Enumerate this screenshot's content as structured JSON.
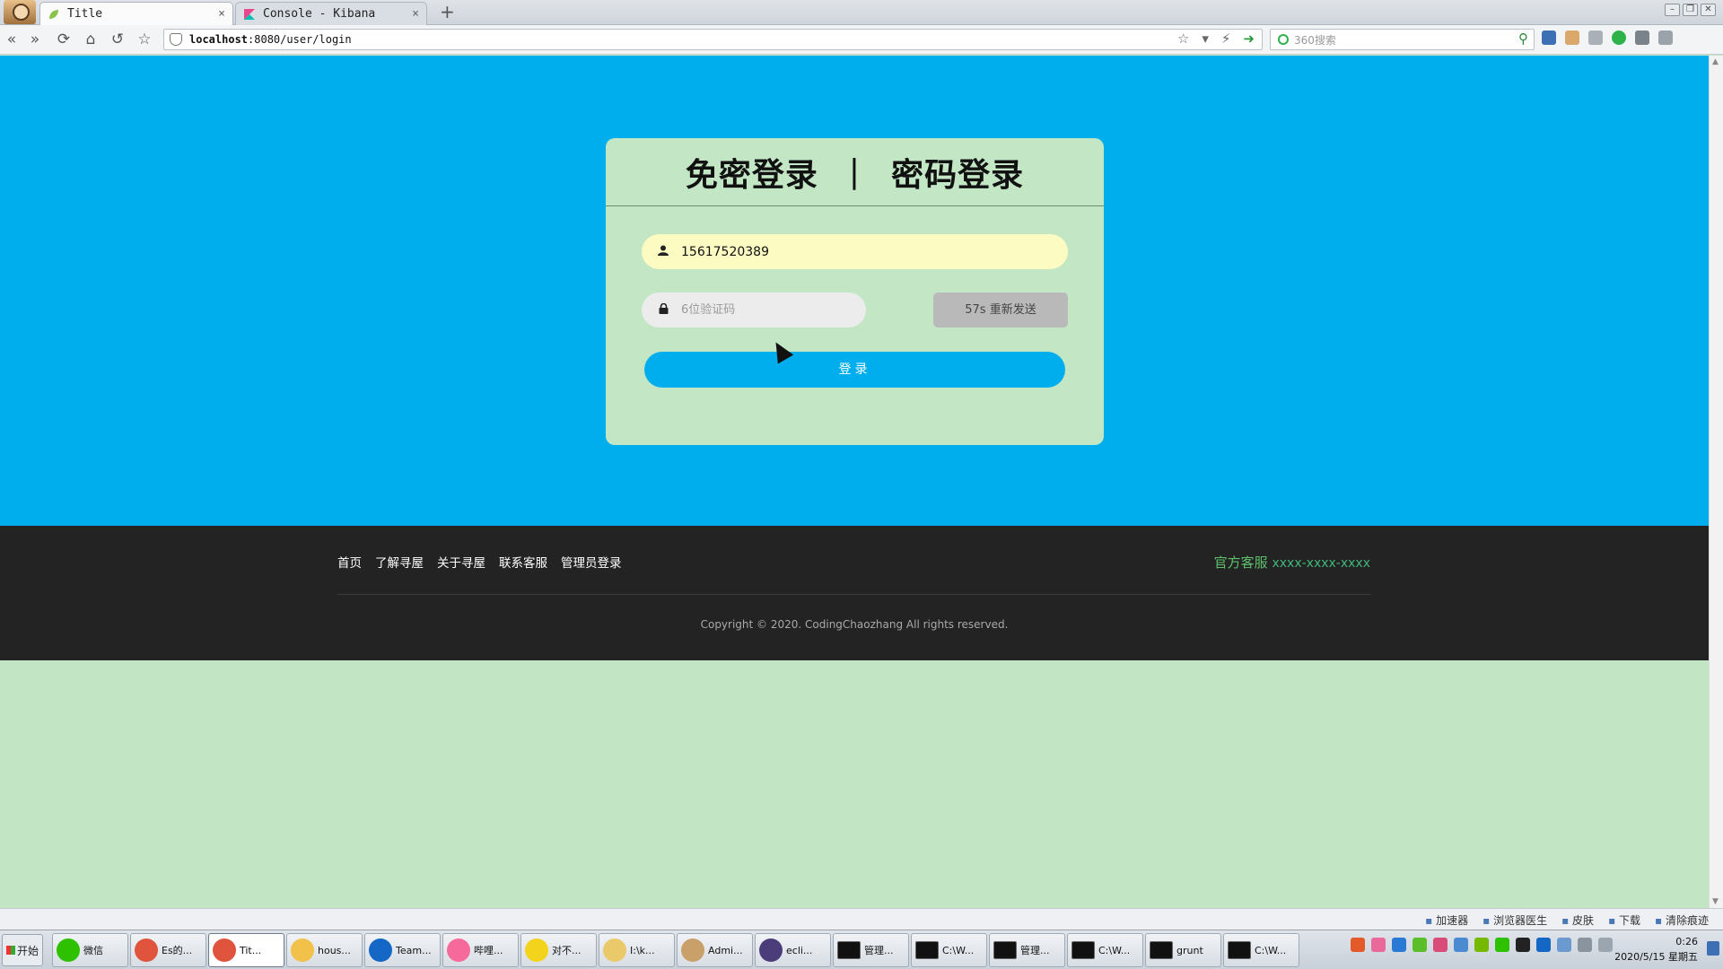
{
  "browser": {
    "tabs": [
      {
        "title": "Title",
        "close": "×",
        "active": true
      },
      {
        "title": "Console - Kibana",
        "close": "×",
        "active": false
      }
    ],
    "new_tab": "+",
    "url_host": "localhost",
    "url_rest": ":8080/user/login",
    "search_placeholder": "360搜索"
  },
  "login": {
    "tab_passwordless": "免密登录",
    "separator": "|",
    "tab_password": "密码登录",
    "phone_value": "15617520389",
    "code_placeholder": "6位验证码",
    "resend_label": "57s 重新发送",
    "login_label": "登录"
  },
  "footer": {
    "links": [
      "首页",
      "了解寻屋",
      "关于寻屋",
      "联系客服",
      "管理员登录"
    ],
    "service_label": "官方客服",
    "service_number": "xxxx-xxxx-xxxx",
    "copyright": "Copyright © 2020. CodingChaozhang All rights reserved."
  },
  "statusbar": {
    "items": [
      "加速器",
      "浏览器医生",
      "皮肤",
      "下载",
      "清除痕迹"
    ]
  },
  "taskbar": {
    "start": "开始",
    "tasks": [
      {
        "label": "微信",
        "color": "#2dc100",
        "icon": "wechat-icon"
      },
      {
        "label": "Es的...",
        "color": "#e0533c",
        "icon": "browser-icon"
      },
      {
        "label": "Tit...",
        "color": "#e0533c",
        "icon": "browser-icon",
        "active": true
      },
      {
        "label": "hous...",
        "color": "#f1c14a",
        "icon": "folder-icon"
      },
      {
        "label": "Team...",
        "color": "#1467c5",
        "icon": "teamviewer-icon"
      },
      {
        "label": "哔哩...",
        "color": "#f56a9a",
        "icon": "bilibili-icon"
      },
      {
        "label": "对不...",
        "color": "#f4d31c",
        "icon": "music-icon"
      },
      {
        "label": "I:\\k...",
        "color": "#e9c96a",
        "icon": "folder-icon"
      },
      {
        "label": "Admi...",
        "color": "#caa06a",
        "icon": "user-icon"
      },
      {
        "label": "ecli...",
        "color": "#4b3c7a",
        "icon": "eclipse-icon"
      },
      {
        "label": "管理...",
        "cmd": true,
        "icon": "cmd-icon"
      },
      {
        "label": "C:\\W...",
        "cmd": true,
        "icon": "cmd-icon"
      },
      {
        "label": "管理...",
        "cmd": true,
        "icon": "cmd-icon"
      },
      {
        "label": "C:\\W...",
        "cmd": true,
        "icon": "cmd-icon"
      },
      {
        "label": "grunt",
        "cmd": true,
        "icon": "cmd-icon"
      },
      {
        "label": "C:\\W...",
        "cmd": true,
        "icon": "cmd-icon"
      }
    ],
    "time": "0:26",
    "date": "2020/5/15 星期五"
  },
  "colors": {
    "hero_bg": "#00aeee",
    "card_bg": "#c3e6c5",
    "footer_bg": "#232323",
    "phone_field_bg": "#fbfbc2",
    "service_green": "#5ec06d"
  }
}
